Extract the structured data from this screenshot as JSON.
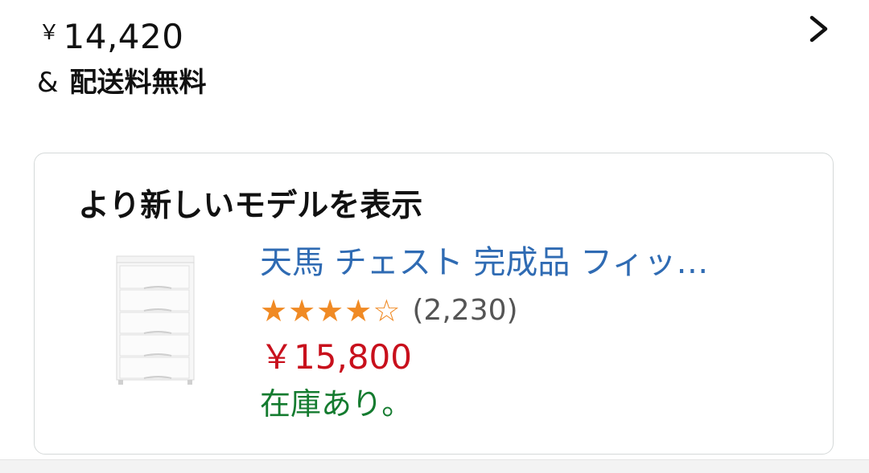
{
  "offer": {
    "currency_symbol": "￥",
    "price": "14,420",
    "amp": "&",
    "shipping": "配送料無料"
  },
  "newer_model": {
    "heading": "より新しいモデルを表示",
    "product_title": "天馬 チェスト 完成品 フィッ…",
    "rating_stars": 4,
    "rating_max": 5,
    "review_count": "(2,230)",
    "price": "￥15,800",
    "availability": "在庫あり。"
  },
  "colors": {
    "link": "#2f6bb3",
    "star": "#f08a24",
    "price": "#c8101c",
    "in_stock": "#147b2f"
  },
  "icons": {
    "chevron": "chevron-right-icon",
    "thumbnail": "white-chest-drawer-product-image"
  }
}
